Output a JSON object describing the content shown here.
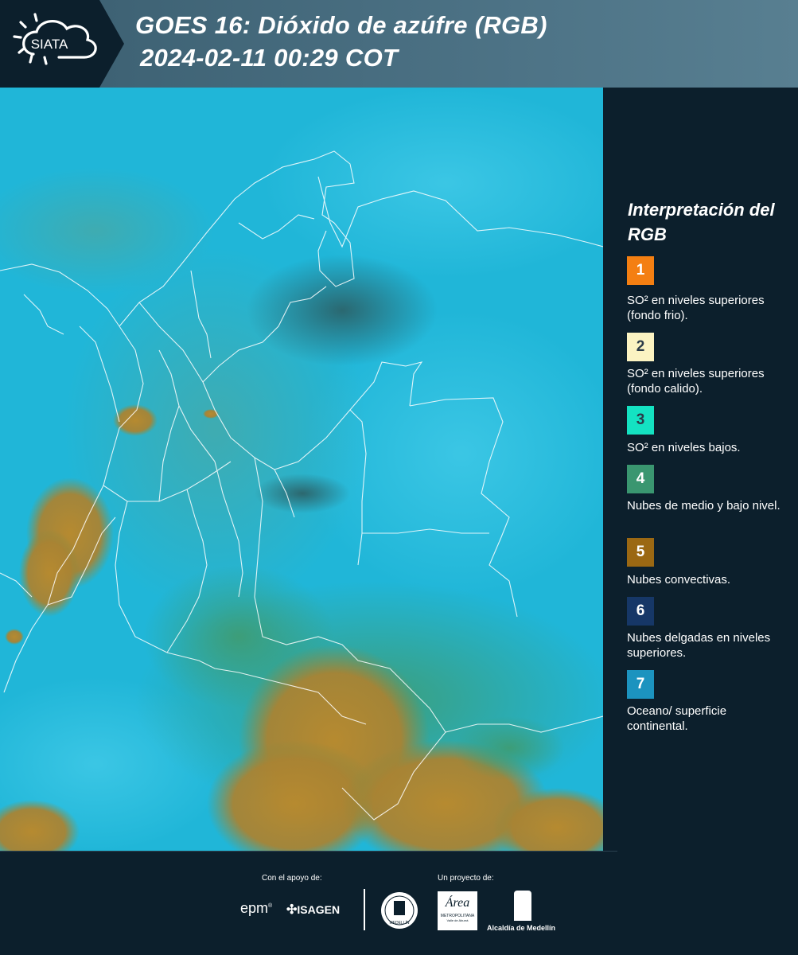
{
  "header": {
    "title_line1": "GOES 16: Dióxido de azúfre (RGB)",
    "title_line2": "2024-02-11 00:29 COT",
    "logo_text": "SIATA"
  },
  "legend": {
    "title": "Interpretación del RGB",
    "items": [
      {
        "number": "1",
        "color": "#f47f12",
        "label": "SO² en niveles superiores (fondo frio)."
      },
      {
        "number": "2",
        "color": "#fbf3c2",
        "label": "SO² en niveles superiores (fondo calido)."
      },
      {
        "number": "3",
        "color": "#14e2c2",
        "label": "SO² en niveles bajos."
      },
      {
        "number": "4",
        "color": "#3a9670",
        "label": "Nubes de medio y bajo nivel."
      },
      {
        "number": "5",
        "color": "#9b6813",
        "label": "Nubes convectivas."
      },
      {
        "number": "6",
        "color": "#163767",
        "label": "Nubes delgadas en niveles superiores."
      },
      {
        "number": "7",
        "color": "#1c93bf",
        "label": "Oceano/ superficie continental."
      }
    ]
  },
  "footer": {
    "support_label": "Con el apoyo de:",
    "project_label": "Un proyecto de:",
    "epm": "epm",
    "isagen": "ISAGEN",
    "area_label": "METROPOLITANA",
    "area_sub": "Valle de Aburrá",
    "area_word": "Área",
    "alcaldia": "Alcaldía de Medellín",
    "medellin_seal": "MEDELLÍN"
  },
  "colors": {
    "background": "#0c1f2c",
    "header_band": "#4d7386",
    "map_base": "#20b6d8",
    "convective": "#b7892d",
    "low_cloud": "#3e9a70"
  }
}
